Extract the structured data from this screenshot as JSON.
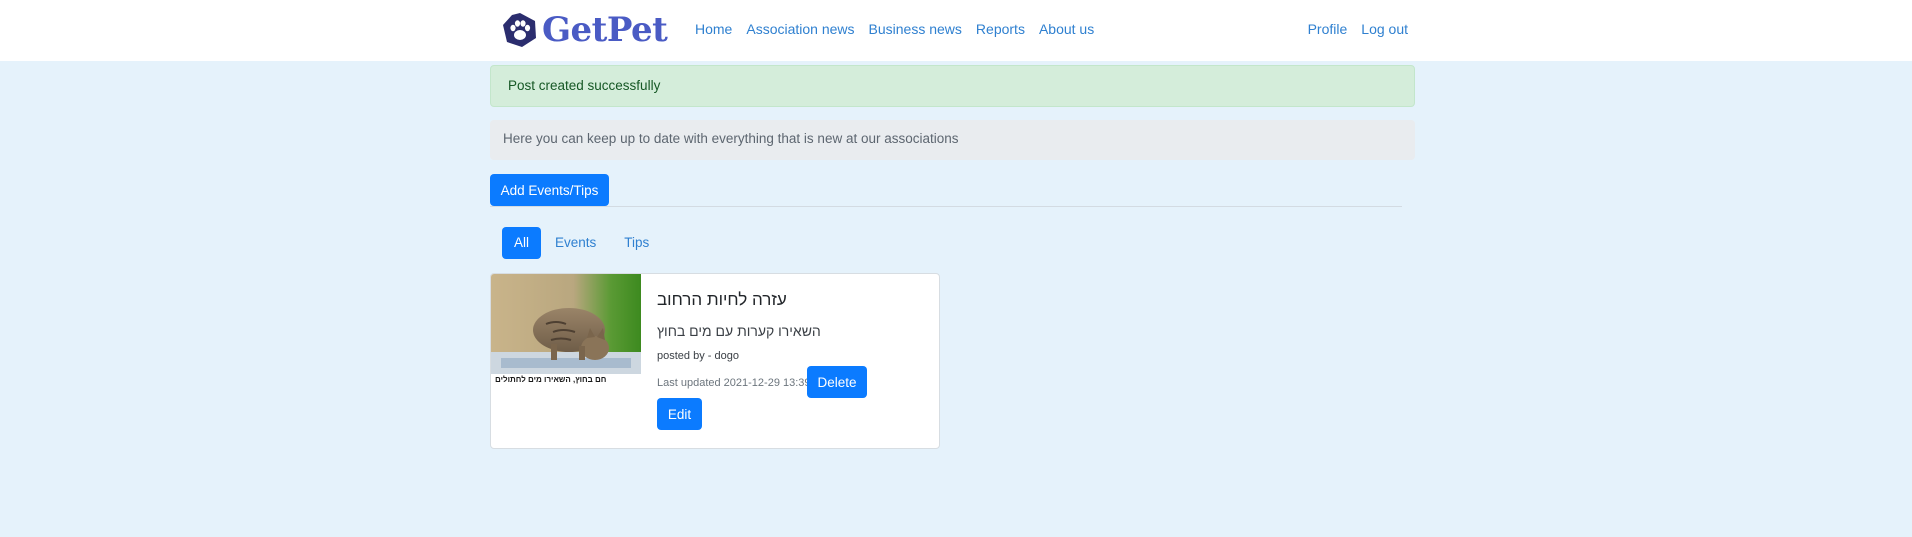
{
  "navbar": {
    "brand": "GetPet",
    "brand_color": "#4a5bc4",
    "logo_icon": "paw-icon",
    "left_links": [
      "Home",
      "Association news",
      "Business news",
      "Reports",
      "About us"
    ],
    "right_links": [
      "Profile",
      "Log out"
    ]
  },
  "alert": {
    "message": "Post created successfully"
  },
  "intro": {
    "text": "Here you can keep up to date with everything that is new at our associations"
  },
  "actions": {
    "add_label": "Add Events/Tips"
  },
  "filter_tabs": {
    "items": [
      "All",
      "Events",
      "Tips"
    ],
    "active": "All"
  },
  "post": {
    "image_caption": "חם בחוץ, השאירו מים לחתולים",
    "title": "עזרה לחיות הרחוב",
    "body": "השאירו קערות עם מים בחוץ",
    "author_line": "posted by - dogo",
    "updated_line": "Last updated 2021-12-29 13:39",
    "delete_label": "Delete",
    "edit_label": "Edit"
  },
  "colors": {
    "page_bg": "#e5f2fb",
    "primary": "#0b7bff",
    "link": "#2f80d0",
    "success_bg": "#d4edda"
  }
}
